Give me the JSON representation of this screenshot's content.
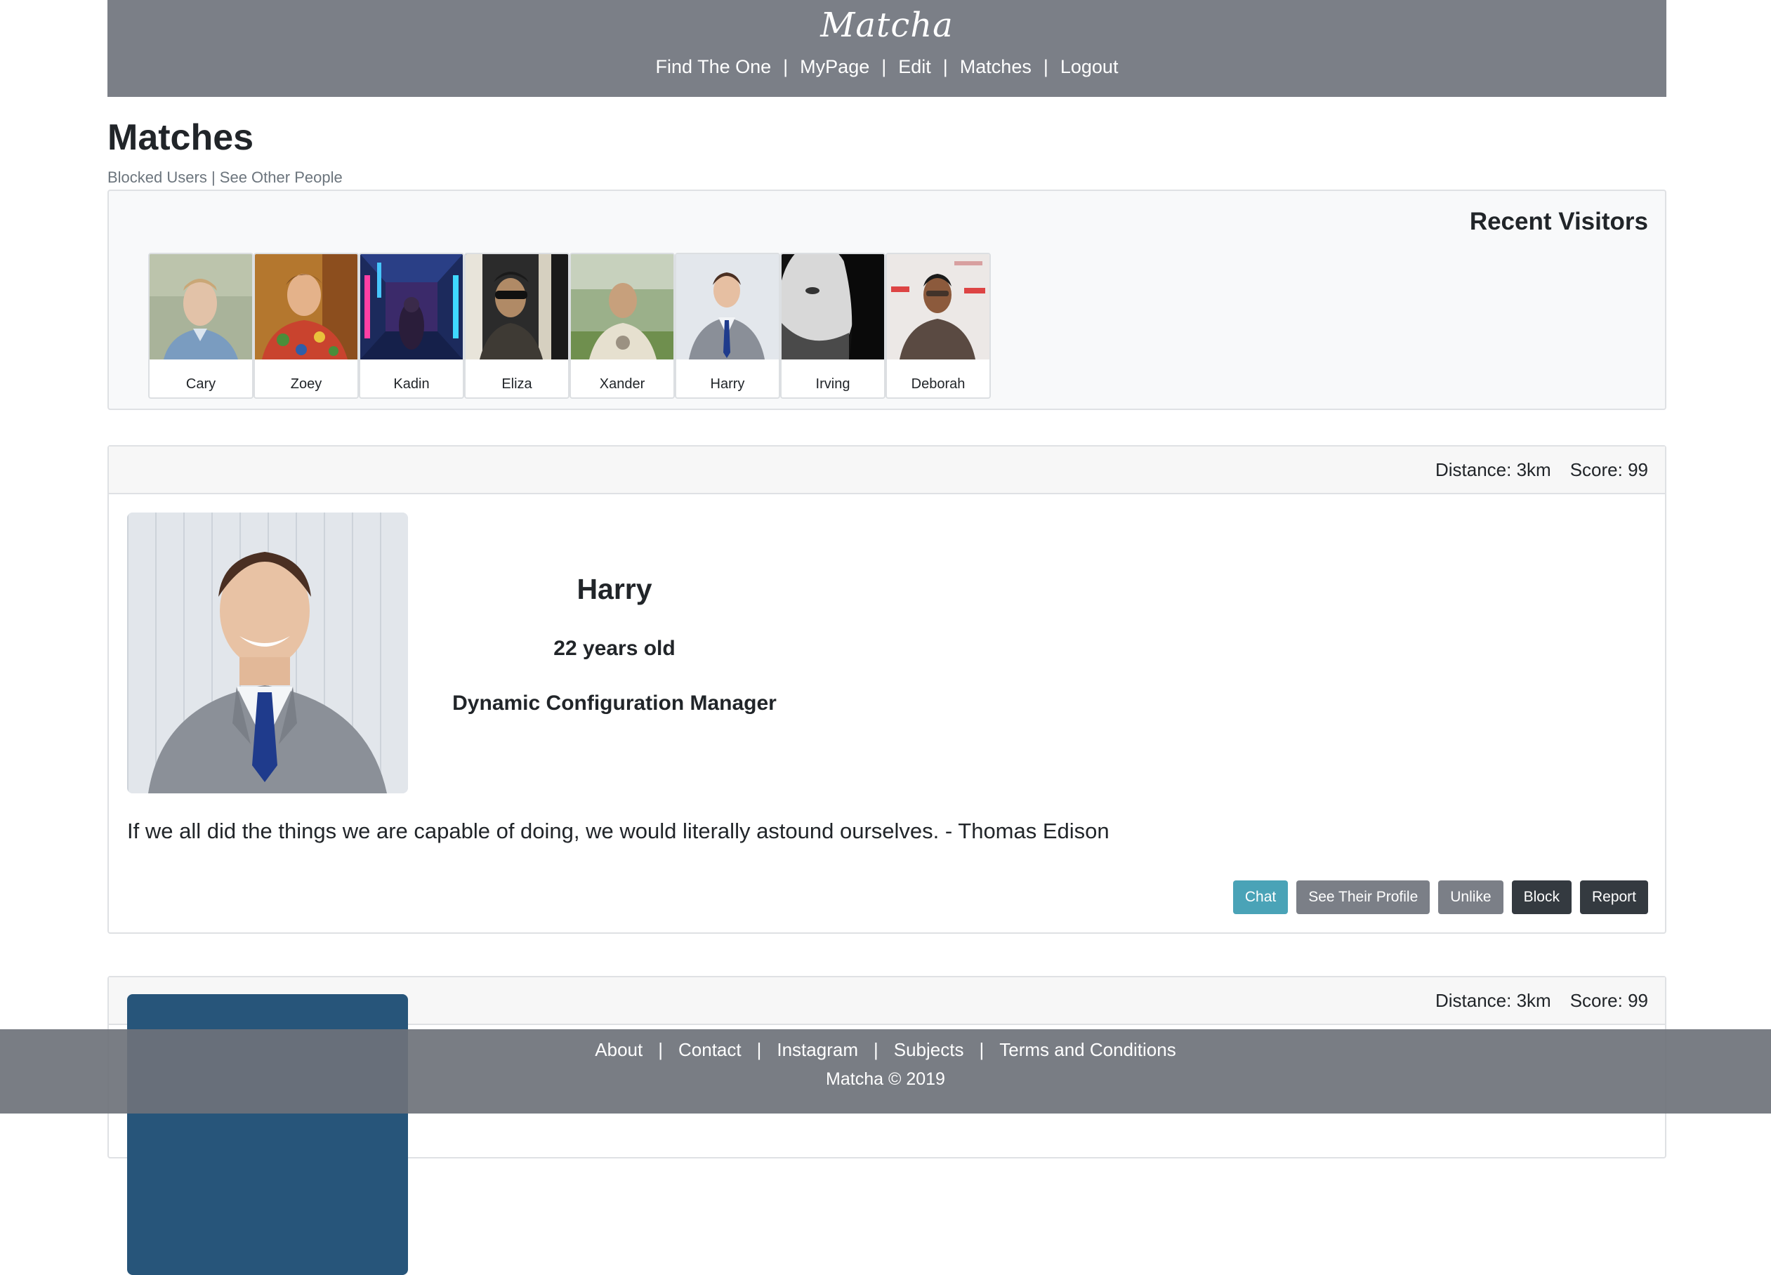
{
  "header": {
    "brand": "Matcha",
    "nav": [
      "Find The One",
      "MyPage",
      "Edit",
      "Matches",
      "Logout"
    ],
    "separator": "|"
  },
  "page": {
    "title": "Matches",
    "links": [
      "Blocked Users",
      "See Other People"
    ],
    "links_separator": " | "
  },
  "recent_visitors": {
    "title": "Recent Visitors",
    "visitors": [
      {
        "name": "Cary"
      },
      {
        "name": "Zoey"
      },
      {
        "name": "Kadin"
      },
      {
        "name": "Eliza"
      },
      {
        "name": "Xander"
      },
      {
        "name": "Harry"
      },
      {
        "name": "Irving"
      },
      {
        "name": "Deborah"
      }
    ]
  },
  "matches": [
    {
      "distance": "Distance: 3km",
      "score": "Score: 99",
      "name": "Harry",
      "age": "22 years old",
      "job": "Dynamic Configuration Manager",
      "bio": "If we all did the things we are capable of doing, we would literally astound ourselves. - Thomas Edison",
      "actions": [
        "Chat",
        "See Their Profile",
        "Unlike",
        "Block",
        "Report"
      ]
    },
    {
      "distance": "Distance: 3km",
      "score": "Score: 99"
    }
  ],
  "footer": {
    "links": [
      "About",
      "Contact",
      "Instagram",
      "Subjects",
      "Terms and Conditions"
    ],
    "separator": "|",
    "copyright": "Matcha © 2019"
  },
  "colors": {
    "header_bg": "#7b7f87",
    "chat_button": "#4aa3b7",
    "secondary_button": "#7b7f87",
    "dark_button": "#343a40"
  }
}
